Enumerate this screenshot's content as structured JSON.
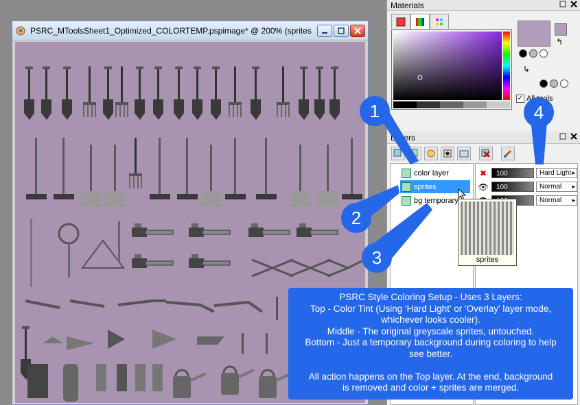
{
  "image_window": {
    "title": "PSRC_MToolsSheet1_Optimized_COLORTEMP.pspimage* @ 200% (sprites"
  },
  "materials": {
    "title": "Materials",
    "all_tools_label": "All tools",
    "foreground_color": "#b19dbb"
  },
  "layers_palette": {
    "title": "Layers",
    "layers": [
      {
        "name": "color layer",
        "opacity": "100",
        "blend": "Hard Light"
      },
      {
        "name": "sprites",
        "opacity": "100",
        "blend": "Normal"
      },
      {
        "name": "bg temporary",
        "opacity": "100",
        "blend": "Normal"
      }
    ],
    "tooltip_label": "sprites"
  },
  "callouts": {
    "numbers": [
      "1",
      "2",
      "3",
      "4"
    ],
    "note_lines": [
      "PSRC Style Coloring Setup - Uses 3 Layers:",
      "Top - Color Tint (Using 'Hard Light' or 'Overlay' layer mode,",
      "whichever looks cooler).",
      "Middle - The original greyscale sprites, untouched.",
      "Bottom - Just a temporary background during coloring to help",
      "see better."
    ],
    "note_lines_2": [
      "All action happens on the Top layer. At the end, background",
      "is removed and color + sprites are merged."
    ]
  },
  "colors": {
    "canvas_background": "#a893b1",
    "callout_blue": "#2467e8",
    "selection_blue": "#3399ff"
  }
}
